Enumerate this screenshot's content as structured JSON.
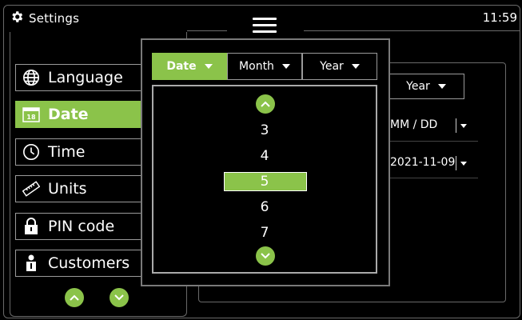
{
  "header": {
    "title": "Settings",
    "time": "11:59",
    "settings_icon": "gear-icon",
    "menu_icon": "hamburger-icon"
  },
  "sidebar": {
    "items": [
      {
        "label": "Language",
        "icon": "globe-icon"
      },
      {
        "label": "Date",
        "icon": "calendar-icon",
        "icon_text": "18",
        "active": true
      },
      {
        "label": "Time",
        "icon": "clock-icon"
      },
      {
        "label": "Units",
        "icon": "ruler-icon"
      },
      {
        "label": "PIN code",
        "icon": "lock-icon"
      },
      {
        "label": "Customers",
        "icon": "person-icon"
      }
    ],
    "scroll_up_icon": "chevron-up-icon",
    "scroll_down_icon": "chevron-down-icon"
  },
  "content": {
    "year_button": "Year",
    "format_value": "MM / DD",
    "date_value": "2021-11-09"
  },
  "picker": {
    "tabs": [
      {
        "label": "Date",
        "active": true
      },
      {
        "label": "Month"
      },
      {
        "label": "Year"
      }
    ],
    "values": [
      "3",
      "4",
      "5",
      "6",
      "7"
    ],
    "selected": "5"
  },
  "colors": {
    "accent": "#8bc34a",
    "background": "#000000",
    "border": "#9a9a9a"
  }
}
